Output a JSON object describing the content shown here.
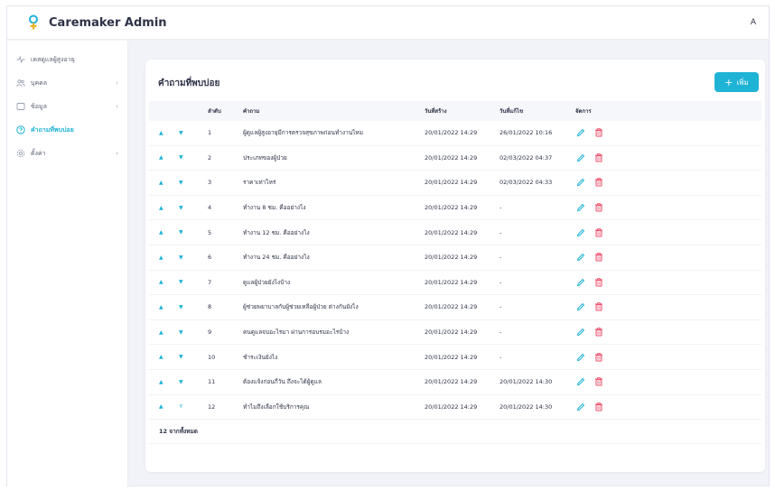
{
  "app": {
    "title": "Caremaker Admin",
    "avatar_initial": "A"
  },
  "sidebar": {
    "items": [
      {
        "label": "เคสดูแลผู้สูงอายุ",
        "icon": "activity-icon",
        "active": false,
        "has_chevron": false
      },
      {
        "label": "บุคคล",
        "icon": "users-icon",
        "active": false,
        "has_chevron": true
      },
      {
        "label": "ข้อมูล",
        "icon": "box-icon",
        "active": false,
        "has_chevron": true
      },
      {
        "label": "คำถามที่พบบ่อย",
        "icon": "help-circle-icon",
        "active": true,
        "has_chevron": false
      },
      {
        "label": "ตั้งค่า",
        "icon": "settings-icon",
        "active": false,
        "has_chevron": true
      }
    ]
  },
  "main": {
    "title": "คำถามที่พบบ่อย",
    "add_button": {
      "icon": "+",
      "label": "เพิ่ม"
    },
    "table": {
      "headers": {
        "no": "ลำดับ",
        "question": "คำถาม",
        "created": "วันที่สร้าง",
        "updated": "วันที่แก้ไข",
        "actions": "จัดการ"
      },
      "rows": [
        {
          "no": "1",
          "question": "ผู้ดูแลผู้สูงอายุมีการตรวจสุขภาพก่อนทำงานไหม",
          "created": "20/01/2022 14:29",
          "updated": "26/01/2022 10:16"
        },
        {
          "no": "2",
          "question": "ประเภทของผู้ป่วย",
          "created": "20/01/2022 14:29",
          "updated": "02/03/2022 04:37"
        },
        {
          "no": "3",
          "question": "ราคาเท่าไหร่",
          "created": "20/01/2022 14:29",
          "updated": "02/03/2022 04:33"
        },
        {
          "no": "4",
          "question": "ทำงาน 8 ชม. คืออย่างไง",
          "created": "20/01/2022 14:29",
          "updated": "-"
        },
        {
          "no": "5",
          "question": "ทำงาน 12 ชม. คืออย่างไง",
          "created": "20/01/2022 14:29",
          "updated": "-"
        },
        {
          "no": "6",
          "question": "ทำงาน 24 ชม. คืออย่างไง",
          "created": "20/01/2022 14:29",
          "updated": "-"
        },
        {
          "no": "7",
          "question": "ดูแลผู้ป่วยยังไงบ้าง",
          "created": "20/01/2022 14:29",
          "updated": "-"
        },
        {
          "no": "8",
          "question": "ผู้ช่วยพยาบาลกับผู้ช่วยเหลือผู้ป่วย ต่างกันยังไง",
          "created": "20/01/2022 14:29",
          "updated": "-"
        },
        {
          "no": "9",
          "question": "คนดูแลจบอะไรมา ผ่านการอบรมอะไรบ้าง",
          "created": "20/01/2022 14:29",
          "updated": "-"
        },
        {
          "no": "10",
          "question": "ชำระเงินยังไง",
          "created": "20/01/2022 14:29",
          "updated": "-"
        },
        {
          "no": "11",
          "question": "ต้องแจ้งก่อนกี่วัน ถึงจะได้ผู้ดูแล",
          "created": "20/01/2022 14:29",
          "updated": "20/01/2022 14:30"
        },
        {
          "no": "12",
          "question": "ทำไมถึงเลือกใช้บริการคุณ",
          "created": "20/01/2022 14:29",
          "updated": "20/01/2022 14:30"
        }
      ],
      "footer": "12 จากทั้งหมด"
    }
  },
  "colors": {
    "accent": "#1fb3d6",
    "delete": "#ef4d6a",
    "background": "#f1f3f8"
  }
}
